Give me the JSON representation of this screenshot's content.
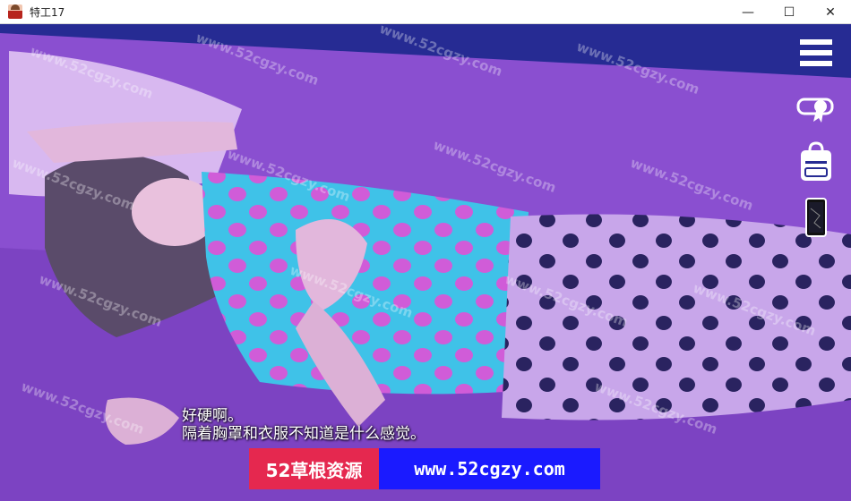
{
  "window": {
    "title": "特工17",
    "controls": {
      "minimize": "—",
      "maximize": "☐",
      "close": "✕"
    }
  },
  "hud": {
    "menu_icon": "hamburger-menu-icon",
    "achievements_icon": "certificate-ribbon-icon",
    "inventory_icon": "backpack-icon",
    "phone_icon": "smartphone-icon"
  },
  "dialogue": {
    "line1": "好硬啊。",
    "line2": "隔着胸罩和衣服不知道是什么感觉。"
  },
  "watermark": {
    "text": "www.52cgzy.com"
  },
  "banner": {
    "left": "52草根资源",
    "right": "www.52cgzy.com"
  },
  "colors": {
    "bed": "#8a4fd0",
    "shirt": "#3fc2e8",
    "polka": "#d05cd8",
    "pants": "#c8a6ea",
    "banner_left_bg": "#e5284f",
    "banner_right_bg": "#1a1aff"
  }
}
